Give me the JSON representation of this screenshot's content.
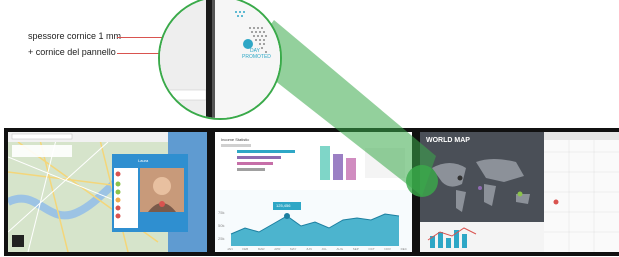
{
  "annotations": {
    "bezel_label": "spessore cornice 1 mm",
    "frame_label": "+ cornice del pannello"
  },
  "panels": {
    "map_call": {
      "person_name": "Laura"
    },
    "dashboard": {
      "title": "Income Statistic",
      "tooltip": "125,456",
      "y_labels": [
        "75k",
        "50k",
        "25k"
      ],
      "months": [
        "JAN",
        "FEB",
        "MAR",
        "APR",
        "MAY",
        "JUN",
        "JUL",
        "AUG",
        "SEP",
        "OCT",
        "NOV",
        "DEC"
      ]
    },
    "world_map": {
      "title": "WORLD MAP"
    }
  },
  "zoom": {
    "badge_line1": "DAY",
    "badge_line2": "PROMOTED"
  },
  "colors": {
    "zoom_green": "#3aaa4a",
    "accent_teal": "#2ea7c6",
    "bezel": "#111111",
    "leader_red": "#d9534f"
  }
}
